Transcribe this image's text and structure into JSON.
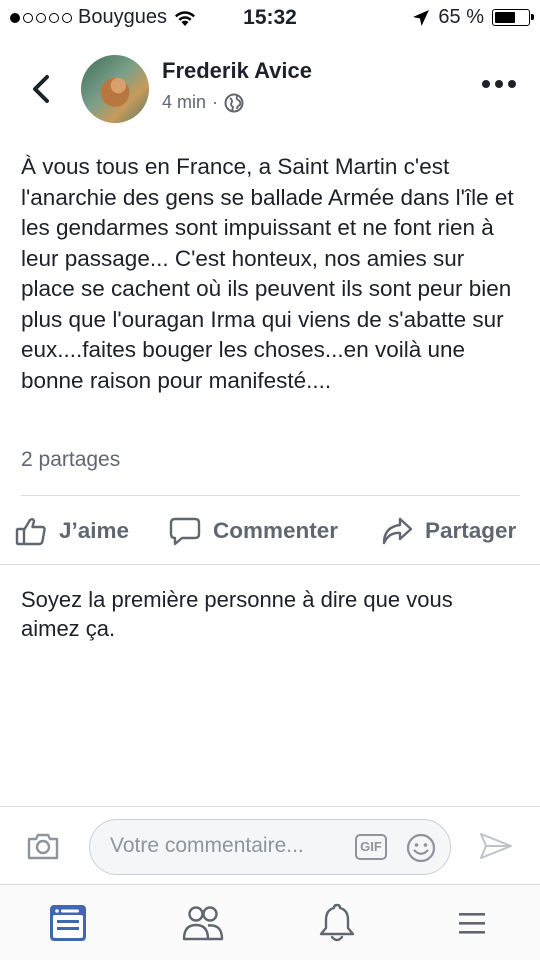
{
  "status_bar": {
    "carrier": "Bouygues",
    "signal_bars": 1,
    "signal_total": 5,
    "time": "15:32",
    "battery_percent": "65 %",
    "battery_level": 0.65
  },
  "header": {
    "author_name": "Frederik Avice",
    "timestamp": "4 min",
    "separator": "·",
    "privacy_icon": "globe-icon"
  },
  "post": {
    "text": "À vous tous en France, a Saint Martin c'est l'anarchie des gens se ballade Armée dans l'île et les gendarmes sont impuissant et ne font rien à leur passage... C'est honteux, nos amies sur place se cachent où ils peuvent ils sont peur bien plus que l'ouragan Irma qui viens de s'abatte sur eux....faites bouger les choses...en voilà une bonne raison pour manifesté....",
    "shares": "2 partages"
  },
  "actions": {
    "like": "J’aime",
    "comment": "Commenter",
    "share": "Partager"
  },
  "reactions": {
    "empty_text": "Soyez la première personne à dire que vous aimez ça."
  },
  "comment_bar": {
    "placeholder": "Votre commentaire...",
    "gif_label": "GIF"
  },
  "tab_bar": {
    "items": [
      "news-feed-icon",
      "friends-icon",
      "notifications-icon",
      "menu-icon"
    ],
    "active": "news-feed-icon",
    "active_color": "#4267b2",
    "inactive_color": "#606770"
  }
}
